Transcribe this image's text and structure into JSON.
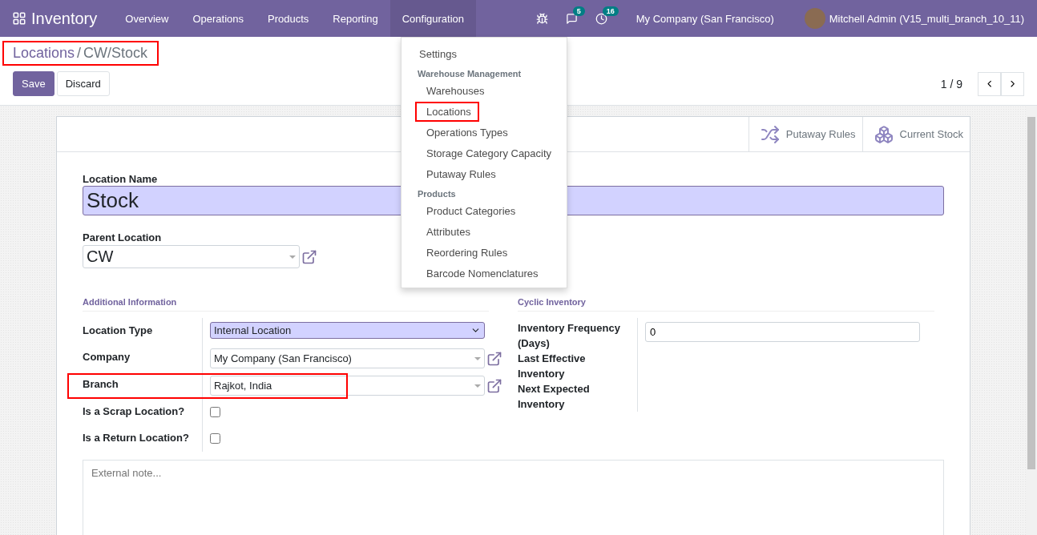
{
  "navbar": {
    "app_name": "Inventory",
    "menus": [
      {
        "label": "Overview",
        "selected": false
      },
      {
        "label": "Operations",
        "selected": false
      },
      {
        "label": "Products",
        "selected": false
      },
      {
        "label": "Reporting",
        "selected": false
      },
      {
        "label": "Configuration",
        "selected": true
      }
    ],
    "messages_count": "5",
    "activities_count": "16",
    "company": "My Company (San Francisco)",
    "user": "Mitchell Admin (V15_multi_branch_10_11)"
  },
  "config_menu": {
    "items": [
      {
        "kind": "item",
        "label": "Settings",
        "highlighted": false
      },
      {
        "kind": "header",
        "label": "Warehouse Management"
      },
      {
        "kind": "subitem",
        "label": "Warehouses",
        "highlighted": false
      },
      {
        "kind": "subitem",
        "label": "Locations",
        "highlighted": true
      },
      {
        "kind": "subitem",
        "label": "Operations Types",
        "highlighted": false
      },
      {
        "kind": "subitem",
        "label": "Storage Category Capacity",
        "highlighted": false
      },
      {
        "kind": "subitem",
        "label": "Putaway Rules",
        "highlighted": false
      },
      {
        "kind": "header",
        "label": "Products"
      },
      {
        "kind": "subitem",
        "label": "Product Categories",
        "highlighted": false
      },
      {
        "kind": "subitem",
        "label": "Attributes",
        "highlighted": false
      },
      {
        "kind": "subitem",
        "label": "Reordering Rules",
        "highlighted": false
      },
      {
        "kind": "subitem",
        "label": "Barcode Nomenclatures",
        "highlighted": false
      }
    ]
  },
  "breadcrumb": {
    "parent": "Locations",
    "separator": "/",
    "current": "CW/Stock",
    "highlighted": true
  },
  "buttons": {
    "save": "Save",
    "discard": "Discard"
  },
  "pager": {
    "value": "1 / 9"
  },
  "smart_buttons": [
    {
      "kind": "putaway",
      "label": "Putaway Rules"
    },
    {
      "kind": "stock",
      "label": "Current Stock"
    }
  ],
  "form": {
    "location_name_label": "Location Name",
    "location_name": "Stock",
    "parent_label": "Parent Location",
    "parent_value": "CW",
    "left_group": {
      "title": "Additional Information",
      "fields": [
        {
          "kind": "select",
          "label": "Location Type",
          "value": "Internal Location"
        },
        {
          "kind": "many2one",
          "label": "Company",
          "value": "My Company (San Francisco)"
        },
        {
          "kind": "many2one",
          "label": "Branch",
          "value": "Rajkot, India",
          "highlighted": true
        },
        {
          "kind": "checkbox",
          "label": "Is a Scrap Location?",
          "checked": false
        },
        {
          "kind": "checkbox",
          "label": "Is a Return Location?",
          "checked": false
        }
      ]
    },
    "right_group": {
      "title": "Cyclic Inventory",
      "fields": [
        {
          "kind": "number",
          "label": "Inventory Frequency (Days)",
          "value": "0"
        },
        {
          "kind": "empty",
          "label": "Last Effective Inventory"
        },
        {
          "kind": "empty",
          "label": "Next Expected Inventory"
        }
      ]
    },
    "note": {
      "placeholder": "External note..."
    }
  }
}
